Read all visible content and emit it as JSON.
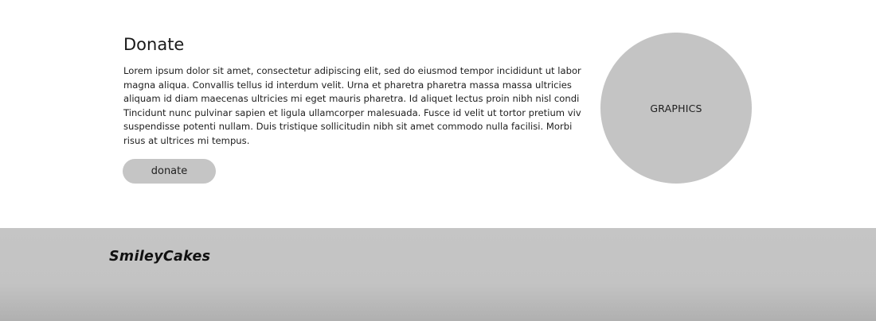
{
  "donate": {
    "title": "Donate",
    "body": "Lorem ipsum dolor sit amet, consectetur adipiscing elit, sed do eiusmod tempor incididunt ut labor magna aliqua. Convallis tellus id interdum velit. Urna et pharetra pharetra massa massa ultricies aliquam id diam maecenas ultricies mi eget mauris pharetra. Id aliquet lectus proin nibh nisl condi Tincidunt nunc pulvinar sapien et ligula ullamcorper malesuada. Fusce id velit ut tortor pretium viv suspendisse potenti nullam. Duis tristique sollicitudin nibh sit amet commodo nulla facilisi. Morbi risus at ultrices mi tempus.",
    "button_label": "donate"
  },
  "graphic": {
    "label": "GRAPHICS"
  },
  "footer": {
    "logo": "SmileyCakes"
  },
  "colors": {
    "placeholder_gray": "#c4c4c4",
    "footer_gray": "#c5c5c5"
  }
}
